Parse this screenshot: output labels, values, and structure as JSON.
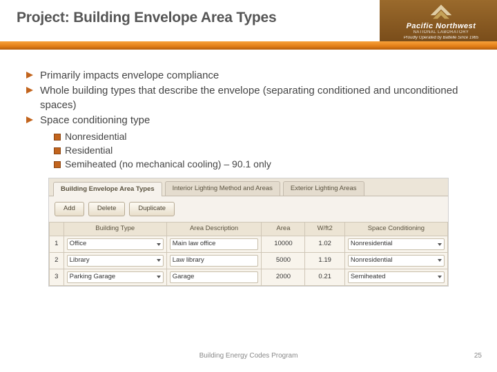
{
  "header": {
    "title": "Project: Building Envelope Area Types",
    "logo": {
      "brand": "Pacific Northwest",
      "sub": "NATIONAL LABORATORY",
      "tagline": "Proudly Operated by Battelle Since 1965"
    }
  },
  "bullets": {
    "b1": "Primarily impacts envelope compliance",
    "b2": "Whole building types that describe the envelope (separating conditioned and unconditioned spaces)",
    "b3": "Space conditioning type",
    "sub1": "Nonresidential",
    "sub2": "Residential",
    "sub3": "Semiheated (no mechanical cooling) – 90.1 only"
  },
  "shot": {
    "tabs": {
      "t1": "Building Envelope Area Types",
      "t2": "Interior Lighting Method and Areas",
      "t3": "Exterior Lighting Areas"
    },
    "buttons": {
      "add": "Add",
      "del": "Delete",
      "dup": "Duplicate"
    },
    "headers": {
      "num": "",
      "btype": "Building Type",
      "adesc": "Area Description",
      "area": "Area",
      "wft2": "W/ft2",
      "scond": "Space Conditioning"
    },
    "rows": [
      {
        "n": "1",
        "btype": "Office",
        "adesc": "Main law office",
        "area": "10000",
        "wft2": "1.02",
        "scond": "Nonresidential"
      },
      {
        "n": "2",
        "btype": "Library",
        "adesc": "Law library",
        "area": "5000",
        "wft2": "1.19",
        "scond": "Nonresidential"
      },
      {
        "n": "3",
        "btype": "Parking Garage",
        "adesc": "Garage",
        "area": "2000",
        "wft2": "0.21",
        "scond": "Semiheated"
      }
    ]
  },
  "footer": {
    "program": "Building Energy Codes Program",
    "page": "25"
  }
}
